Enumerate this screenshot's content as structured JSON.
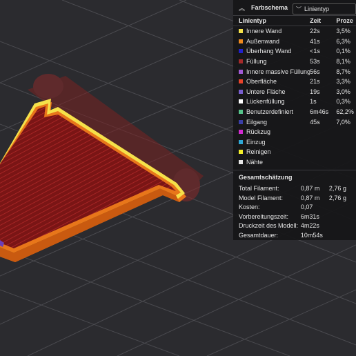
{
  "panel": {
    "title": "Farbschema",
    "dropdown_value": "Linientyp",
    "headers": [
      "Linientyp",
      "Zeit",
      "Proze"
    ],
    "rows": [
      {
        "label": "Innere Wand",
        "time": "22s",
        "pct": "3,5%",
        "color": "#f5e14a"
      },
      {
        "label": "Außenwand",
        "time": "41s",
        "pct": "6,3%",
        "color": "#f08a1e"
      },
      {
        "label": "Überhang Wand",
        "time": "<1s",
        "pct": "0,1%",
        "color": "#2222cc"
      },
      {
        "label": "Füllung",
        "time": "53s",
        "pct": "8,1%",
        "color": "#a52a2a"
      },
      {
        "label": "Innere massive Füllung",
        "time": "56s",
        "pct": "8,7%",
        "color": "#a25bd6"
      },
      {
        "label": "Oberfläche",
        "time": "21s",
        "pct": "3,3%",
        "color": "#e8442c"
      },
      {
        "label": "Untere Fläche",
        "time": "19s",
        "pct": "3,0%",
        "color": "#7a5fd0"
      },
      {
        "label": "Lückenfüllung",
        "time": "1s",
        "pct": "0,3%",
        "color": "#ffffff"
      },
      {
        "label": "Benutzerdefiniert",
        "time": "6m46s",
        "pct": "62,2%",
        "color": "#56c48a"
      },
      {
        "label": "Eilgang",
        "time": "45s",
        "pct": "7,0%",
        "color": "#3b3fa8"
      },
      {
        "label": "Rückzug",
        "time": "",
        "pct": "",
        "color": "#d22cd2"
      },
      {
        "label": "Einzug",
        "time": "",
        "pct": "",
        "color": "#2fa8d6"
      },
      {
        "label": "Reinigen",
        "time": "",
        "pct": "",
        "color": "#f2ee2a"
      },
      {
        "label": "Nähte",
        "time": "",
        "pct": "",
        "color": "#e6e6e6"
      }
    ],
    "summary_title": "Gesamtschätzung",
    "summary": [
      {
        "label": "Total Filament:",
        "v1": "0,87 m",
        "v2": "2,76 g"
      },
      {
        "label": "Model Filament:",
        "v1": "0,87 m",
        "v2": "2,76 g"
      },
      {
        "label": "Kosten:",
        "v1": "0,07",
        "v2": ""
      },
      {
        "label": "Vorbereitungszeit:",
        "v1": "6m31s",
        "v2": ""
      },
      {
        "label": "Druckzeit des Modell:",
        "v1": "4m22s",
        "v2": ""
      },
      {
        "label": "Gesamtdauer:",
        "v1": "10m54s",
        "v2": ""
      }
    ]
  },
  "colors": {
    "background": "#2b2b2f",
    "grid": "#4a4a4f",
    "fill": "#8e1a1a",
    "outer_wall": "#e8761a",
    "inner_wall": "#f5e14a"
  }
}
